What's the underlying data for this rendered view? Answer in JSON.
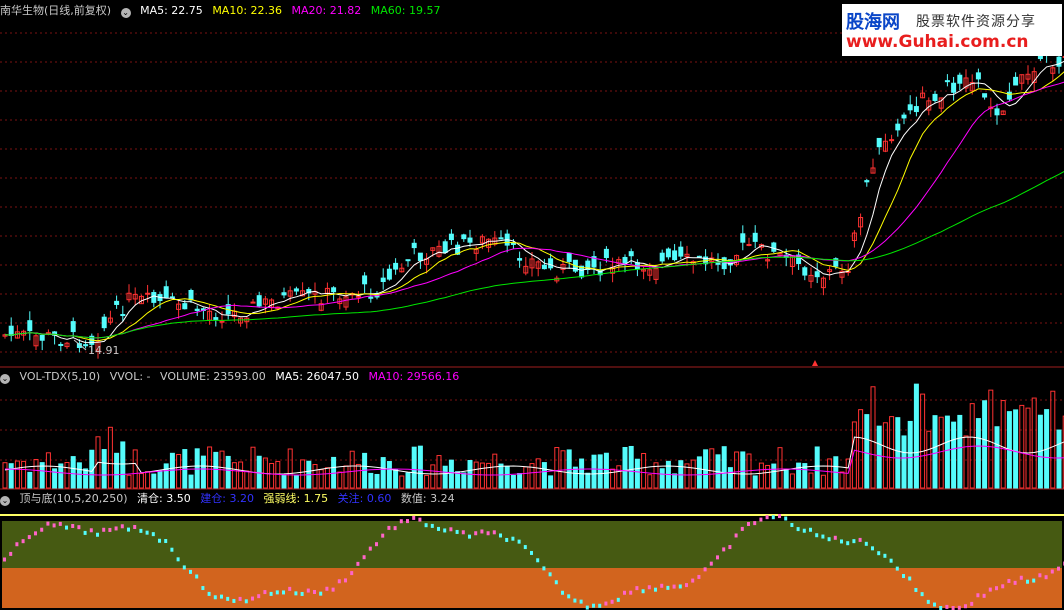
{
  "price_panel": {
    "title": "南华生物(日线,前复权)",
    "ma5": "MA5: 22.75",
    "ma10": "MA10: 22.36",
    "ma20": "MA20: 21.82",
    "ma60": "MA60: 19.57",
    "low_marker": "14.91",
    "colors": {
      "up": "#ff3232",
      "down": "#54fcfc",
      "ma5": "#ffffff",
      "ma10": "#ffff00",
      "ma20": "#ff00ff",
      "ma60": "#00e600"
    }
  },
  "volume_panel": {
    "indicator": "VOL-TDX(5,10)",
    "vvol": "VVOL: -",
    "volume": "VOLUME: 23593.00",
    "ma5": "MA5: 26047.50",
    "ma10": "MA10: 29566.16"
  },
  "indicator_panel": {
    "indicator": "顶与底(10,5,20,250)",
    "clear": "清仓: 3.50",
    "unknown": "建仓: 3.20",
    "strong_weak": "强弱线: 1.75",
    "watch": "关注: 0.60",
    "value": "数值: 3.24",
    "colors": {
      "upper_band": "#465a12",
      "lower_band": "#d2641e",
      "top_line": "#ffff64"
    }
  },
  "watermark": {
    "brand": "股海网",
    "tagline": "股票软件资源分享",
    "url": "www.Guhai.com.cn"
  },
  "icons": {
    "collapse": "circle-chevron-icon"
  }
}
